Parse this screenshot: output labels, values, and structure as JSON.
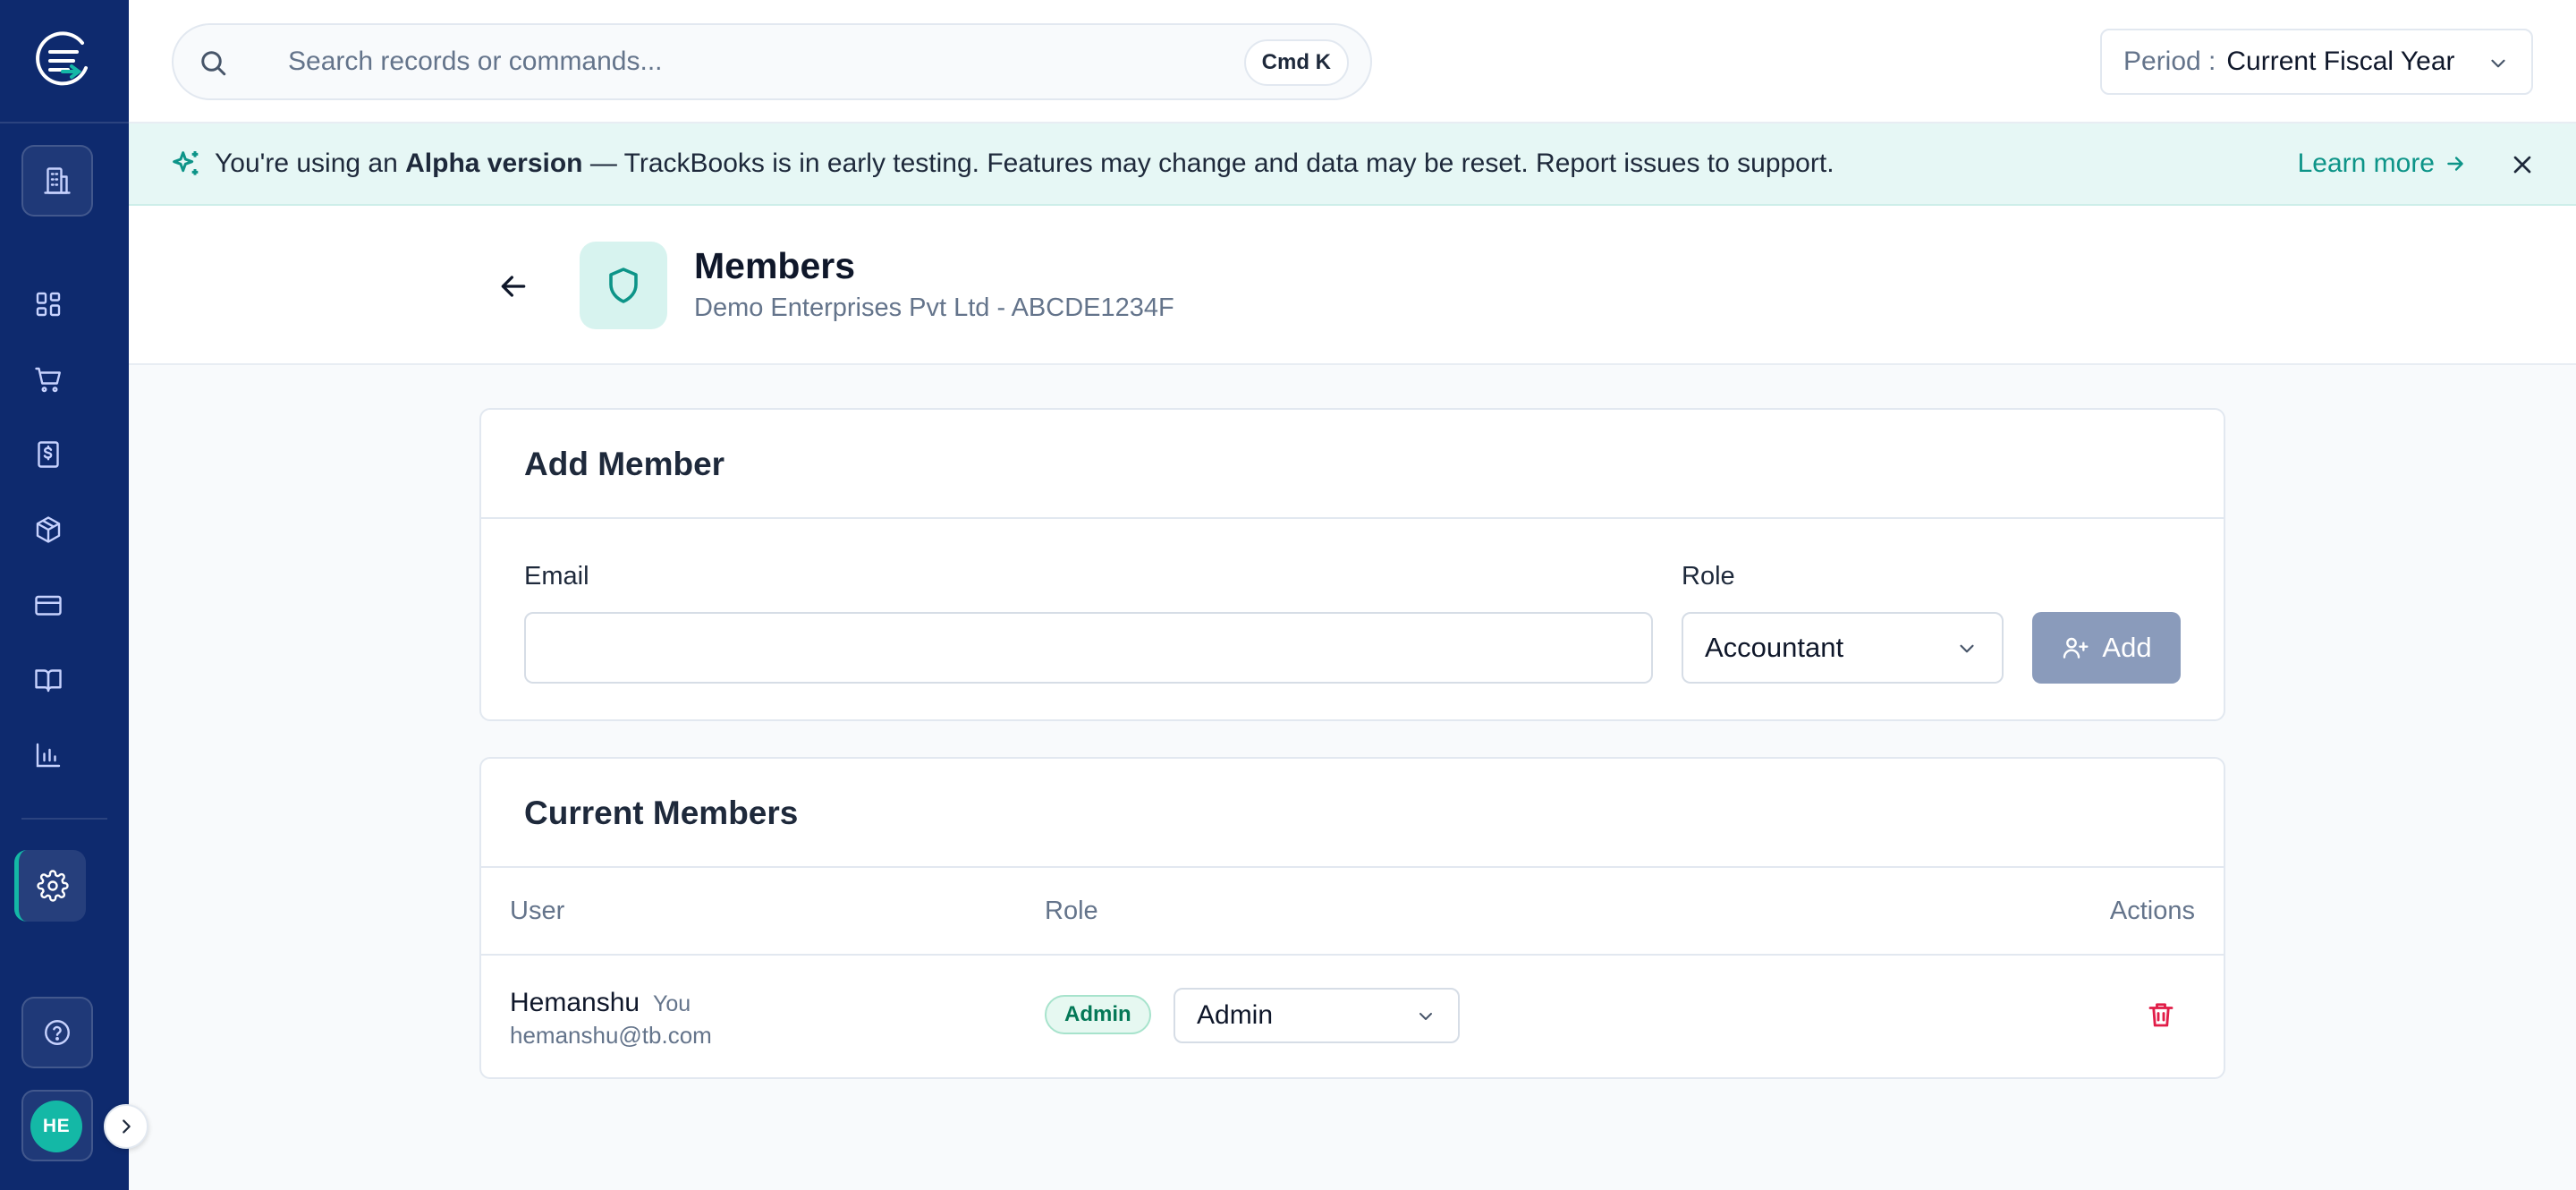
{
  "app": {
    "colors": {
      "sidebar": "#0e2a6e",
      "accent": "#14b8a6",
      "accent_text": "#0d9488",
      "banner_bg": "#e6f7f5",
      "disabled_button": "#8a9bbb",
      "danger": "#e11d48"
    }
  },
  "sidebar": {
    "items": [
      {
        "icon": "building-icon"
      },
      {
        "icon": "dashboard-grid-icon"
      },
      {
        "icon": "shopping-cart-icon"
      },
      {
        "icon": "invoice-dollar-icon"
      },
      {
        "icon": "package-box-icon"
      },
      {
        "icon": "credit-card-icon"
      },
      {
        "icon": "book-open-icon"
      },
      {
        "icon": "bar-chart-icon"
      },
      {
        "icon": "gear-icon"
      },
      {
        "icon": "help-circle-icon"
      }
    ],
    "avatar_initials": "HE"
  },
  "topbar": {
    "search_placeholder": "Search records or commands...",
    "shortcut": "Cmd K",
    "period_label": "Period :",
    "period_value": "Current Fiscal Year"
  },
  "banner": {
    "prefix": "You're using an ",
    "highlight": "Alpha version",
    "suffix": " — TrackBooks is in early testing. Features may change and data may be reset. Report issues to support.",
    "link": "Learn more"
  },
  "page": {
    "title": "Members",
    "subtitle": "Demo Enterprises Pvt Ltd - ABCDE1234F"
  },
  "add_member": {
    "title": "Add Member",
    "email_label": "Email",
    "email_value": "",
    "role_label": "Role",
    "role_value": "Accountant",
    "add_button": "Add"
  },
  "current_members": {
    "title": "Current Members",
    "columns": [
      "User",
      "Role",
      "Actions"
    ],
    "rows": [
      {
        "name": "Hemanshu",
        "tag": "You",
        "email": "hemanshu@tb.com",
        "badge": "Admin",
        "role": "Admin"
      }
    ]
  }
}
